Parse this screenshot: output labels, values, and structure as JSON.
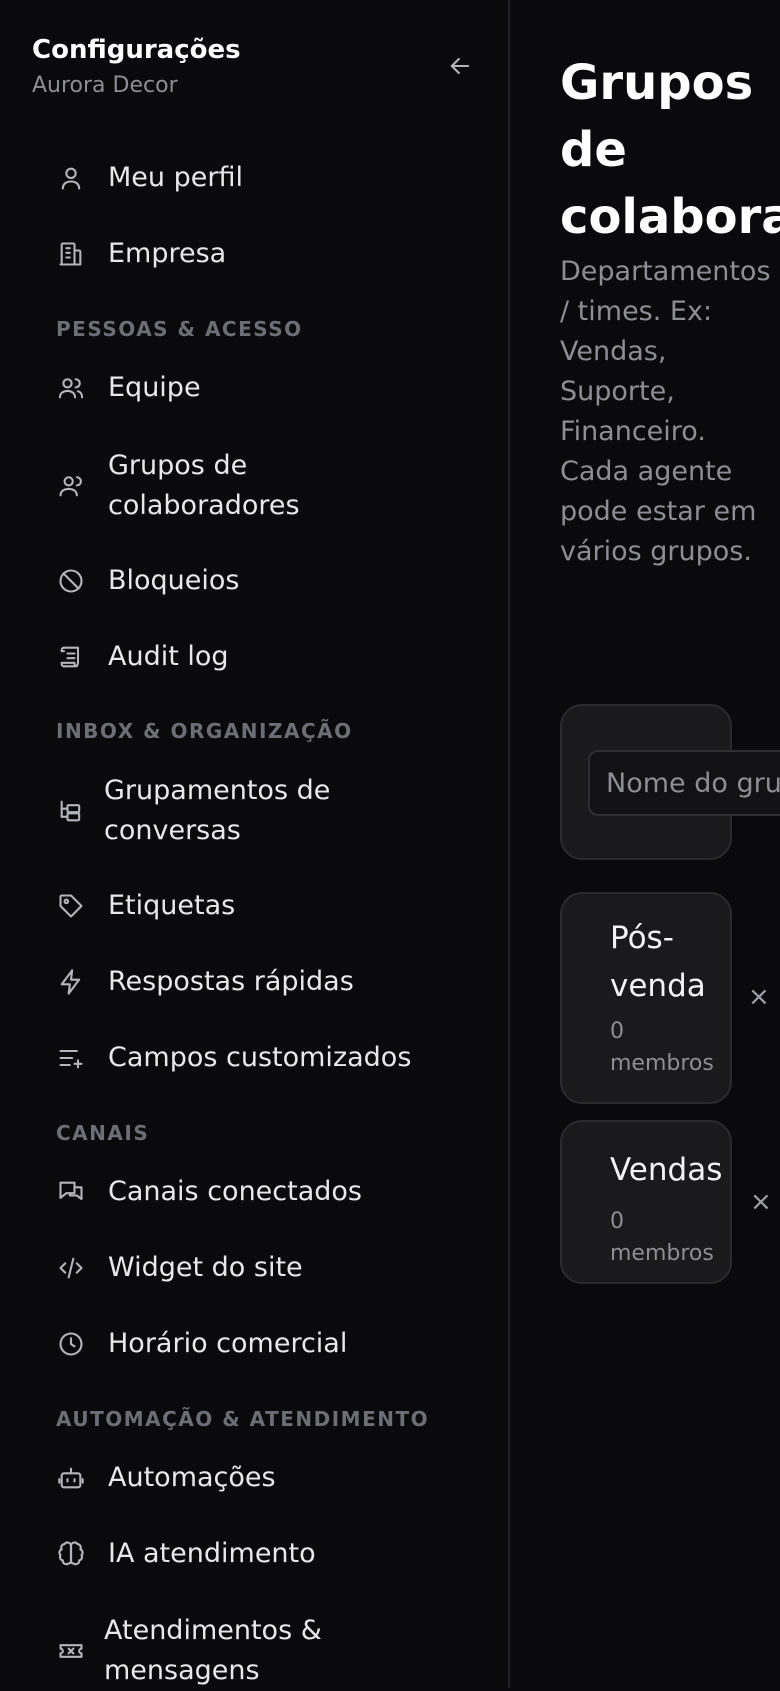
{
  "sidebar": {
    "title": "Configurações",
    "subtitle": "Aurora Decor",
    "items": {
      "perfil": "Meu perfil",
      "empresa": "Empresa",
      "equipe": "Equipe",
      "grupos": "Grupos de colaboradores",
      "bloqueios": "Bloqueios",
      "audit": "Audit log",
      "grupamentos": "Grupamentos de conversas",
      "etiquetas": "Etiquetas",
      "respostas": "Respostas rápidas",
      "campos": "Campos customizados",
      "canais": "Canais conectados",
      "widget": "Widget do site",
      "horario": "Horário comercial",
      "automacoes": "Automações",
      "ia": "IA atendimento",
      "atendimentos": "Atendimentos & mensagens"
    },
    "sections": {
      "pessoas": "PESSOAS & ACESSO",
      "inbox": "INBOX & ORGANIZAÇÃO",
      "canais": "CANAIS",
      "automacao": "AUTOMAÇÃO & ATENDIMENTO"
    }
  },
  "main": {
    "title": "Grupos\nde\ncolaboradores",
    "description": "Departamentos / times. Ex: Vendas, Suporte, Financeiro. Cada agente pode estar em vários grupos.",
    "input_placeholder": "Nome do grupo",
    "groups": [
      {
        "name": "Pós-venda",
        "members": "0 membros"
      },
      {
        "name": "Vendas",
        "members": "0 membros"
      }
    ],
    "remove_symbol": "×"
  }
}
